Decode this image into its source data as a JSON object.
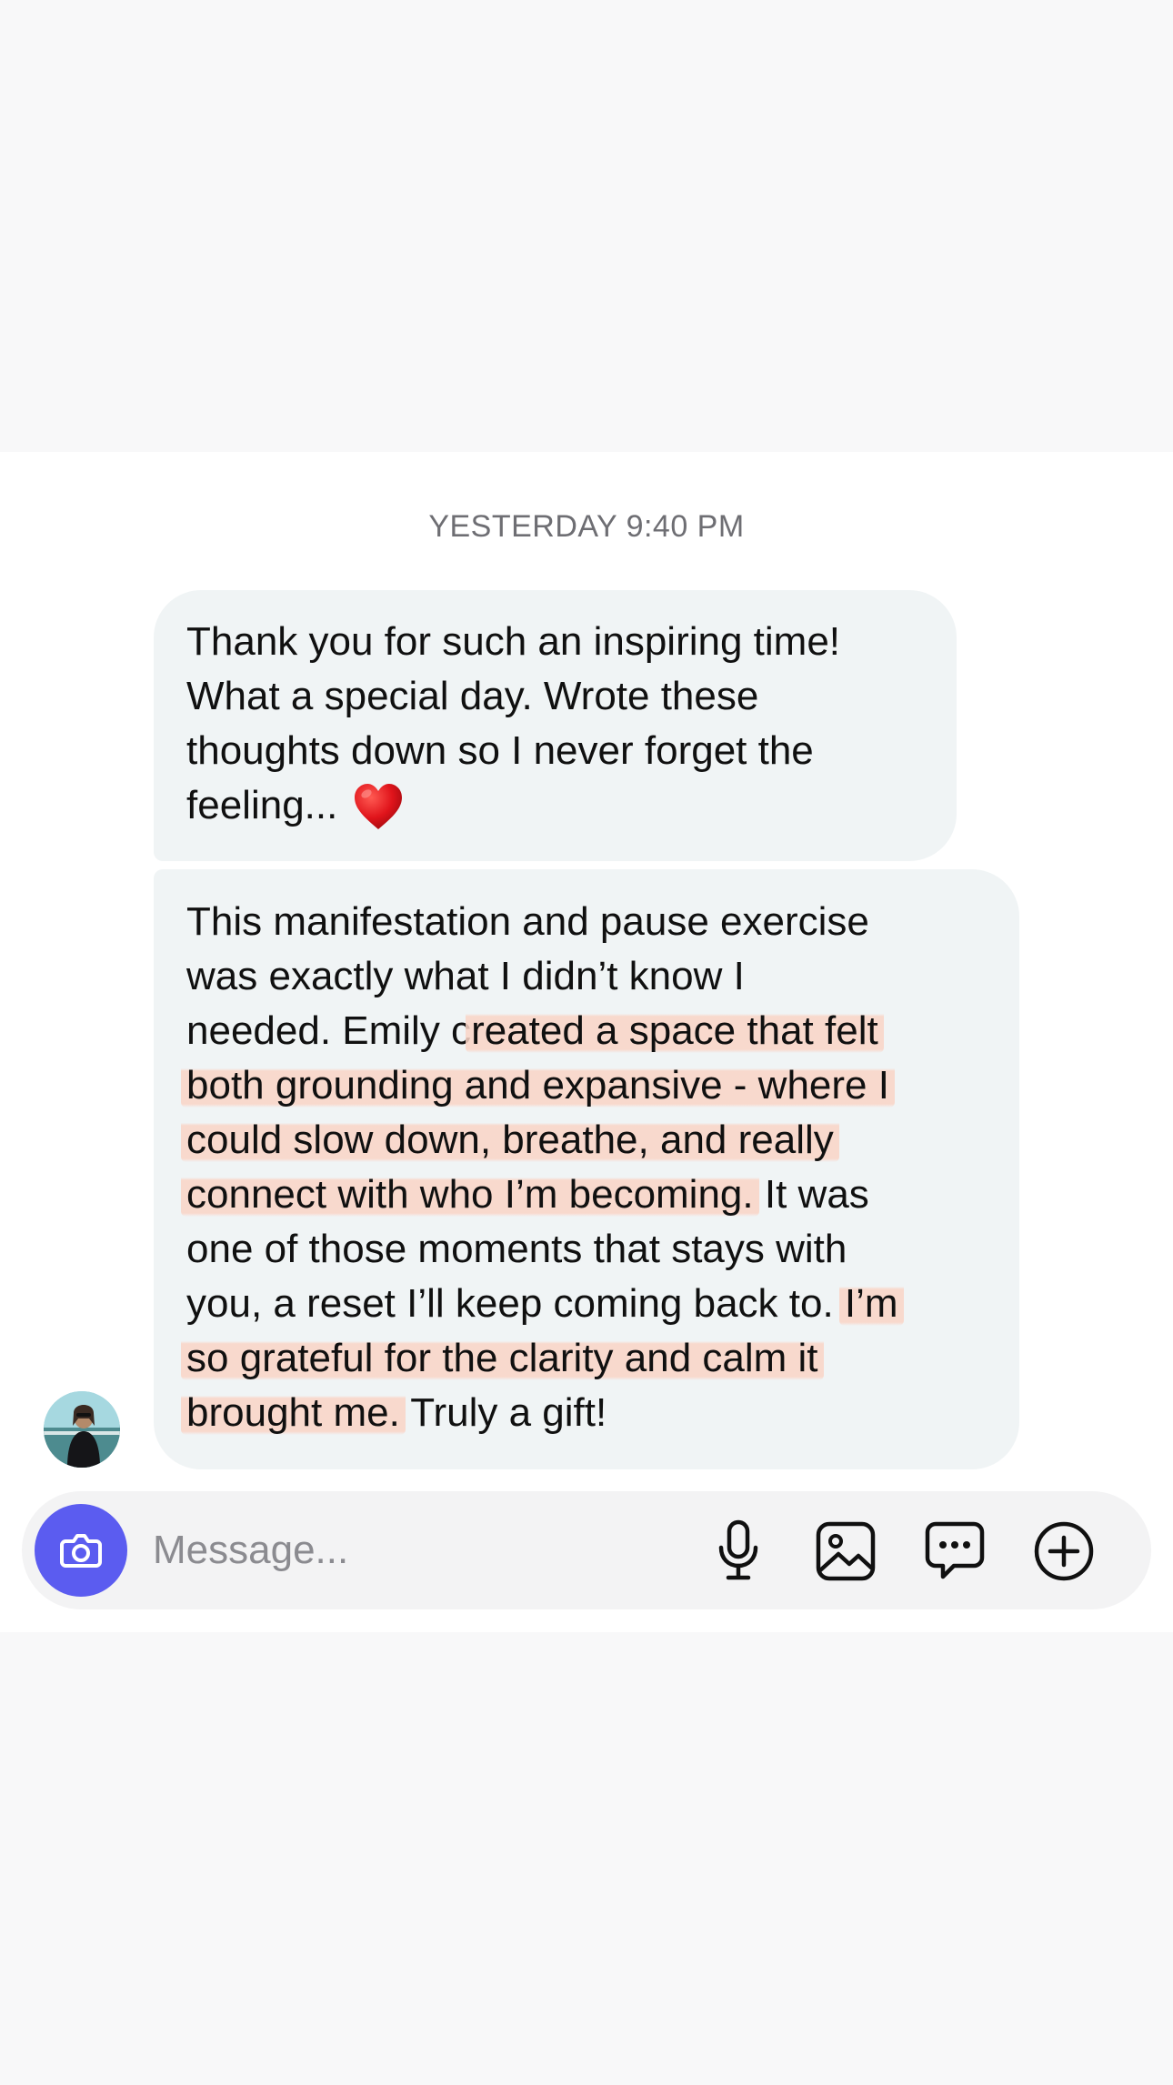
{
  "conversation": {
    "timestamp": "YESTERDAY 9:40 PM",
    "messages": [
      {
        "lines": [
          "Thank you for such an inspiring time!",
          "What a special day. Wrote these",
          "thoughts down so I never forget the",
          "feeling..."
        ],
        "emoji": "red-heart"
      },
      {
        "lines": [
          {
            "plain": "This manifestation and pause exercise"
          },
          {
            "plain": "was exactly what I didn’t know I"
          },
          {
            "plain": "needed. Emily c",
            "highlight": "reated a space that felt"
          },
          {
            "highlight": "both grounding and expansive - where I"
          },
          {
            "highlight": "could slow down, breathe, and really"
          },
          {
            "highlight": "connect with who I’m becoming.",
            "plain_after": " It was"
          },
          {
            "plain": "one of those moments that stays with"
          },
          {
            "plain": "you, a reset I’ll keep coming back to. ",
            "highlight": "I’m"
          },
          {
            "highlight": "so grateful for the clarity and calm it"
          },
          {
            "highlight": "brought me.",
            "plain_after": " Truly a gift!"
          }
        ]
      }
    ]
  },
  "composer": {
    "placeholder": "Message...",
    "icons": [
      "camera-icon",
      "microphone-icon",
      "gallery-icon",
      "chat-bubble-icon",
      "plus-circle-icon"
    ],
    "accent_color": "#5b5cf0"
  },
  "colors": {
    "bubble": "#f0f4f5",
    "highlight": "#fad4c6",
    "timestamp": "#6e6e73"
  }
}
